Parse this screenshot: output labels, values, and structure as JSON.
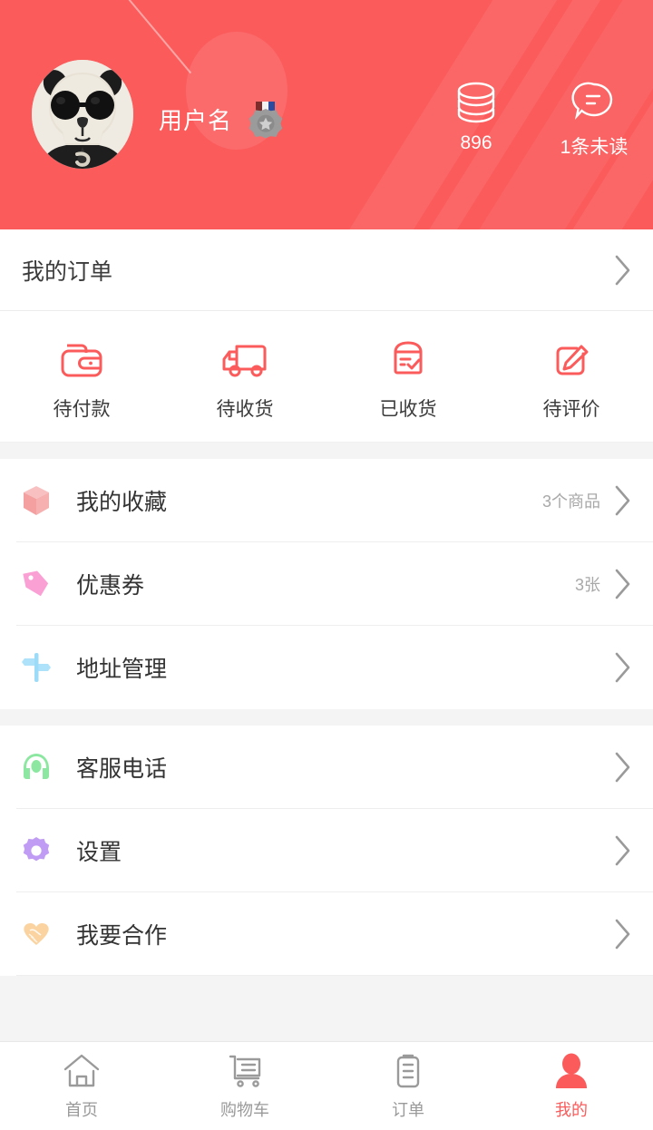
{
  "theme": {
    "brand": "#fb5b5b",
    "header_bg": "#fb5b5b",
    "page_bg": "#f4f4f4",
    "text_primary": "#333333",
    "text_secondary": "#a8a8a8",
    "divider": "#eeeeee"
  },
  "header": {
    "avatar_name": "panda-skull-avatar",
    "username": "用户名",
    "badge_name": "medal-badge",
    "stats": [
      {
        "icon": "coins-icon",
        "value": "896"
      },
      {
        "icon": "chat-bubble-icon",
        "value": "1条未读"
      }
    ]
  },
  "my_order": {
    "title": "我的订单",
    "chevron": "chevron-right-icon"
  },
  "order_status": [
    {
      "icon": "wallet-icon",
      "label": "待付款"
    },
    {
      "icon": "truck-icon",
      "label": "待收货"
    },
    {
      "icon": "box-check-icon",
      "label": "已收货"
    },
    {
      "icon": "pencil-square-icon",
      "label": "待评价"
    }
  ],
  "menu_group_1": [
    {
      "icon": "cube-icon",
      "icon_color": "#f4a7a7",
      "label": "我的收藏",
      "value": "3个商品"
    },
    {
      "icon": "tag-icon",
      "icon_color": "#f9a0d0",
      "label": "优惠券",
      "value": "3张"
    },
    {
      "icon": "signpost-icon",
      "icon_color": "#9ddcf8",
      "label": "地址管理",
      "value": ""
    }
  ],
  "menu_group_2": [
    {
      "icon": "telephone-icon",
      "icon_color": "#96eda6",
      "label": "客服电话",
      "value": ""
    },
    {
      "icon": "gear-icon",
      "icon_color": "#c19cf5",
      "label": "设置",
      "value": ""
    },
    {
      "icon": "handshake-icon",
      "icon_color": "#fbd3a0",
      "label": "我要合作",
      "value": ""
    }
  ],
  "tabbar": [
    {
      "icon": "home-icon",
      "label": "首页",
      "active": false
    },
    {
      "icon": "cart-icon",
      "label": "购物车",
      "active": false
    },
    {
      "icon": "clipboard-icon",
      "label": "订单",
      "active": false
    },
    {
      "icon": "person-icon",
      "label": "我的",
      "active": true
    }
  ]
}
